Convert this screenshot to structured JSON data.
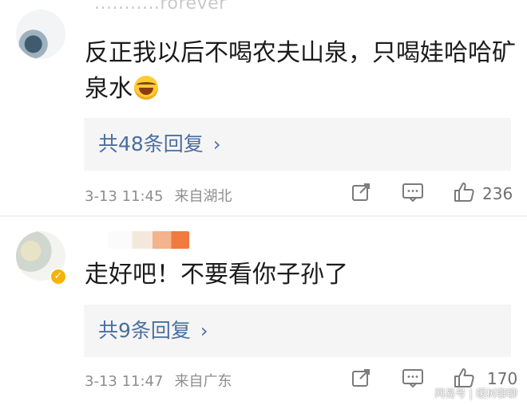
{
  "comments": [
    {
      "username": "...........rorever",
      "text": "反正我以后不喝农夫山泉，只喝娃哈哈矿泉水",
      "emoji": "face-with-tears-of-joy",
      "replies_label": "共48条回复",
      "date": "3-13 11:45",
      "location": "来自湖北",
      "likes": "236"
    },
    {
      "text": "走好吧！不要看你子孙了",
      "verified": true,
      "replies_label": "共9条回复",
      "date": "3-13 11:47",
      "location": "来自广东",
      "likes": "170"
    }
  ],
  "watermark": "网易号 | 暖树聊聊",
  "colors": {
    "link": "#4a6ea0",
    "reply_bg": "#f5f5f5",
    "meta_text": "#8e8e8e",
    "verified_badge": "#f5b400"
  }
}
